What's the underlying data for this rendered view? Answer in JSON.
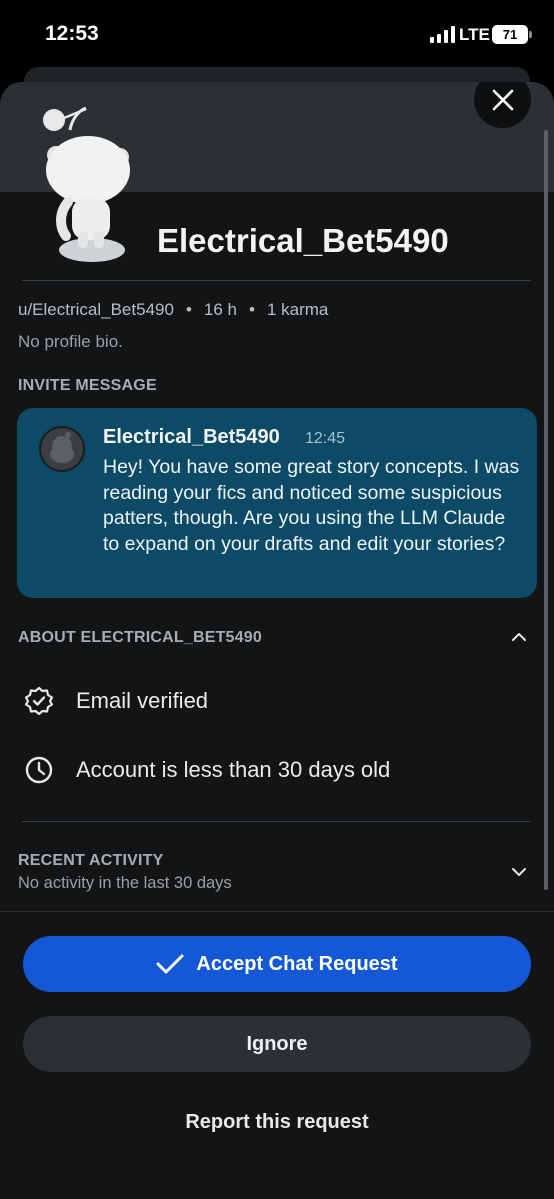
{
  "status_bar": {
    "time": "12:53",
    "network": "LTE",
    "battery": "71"
  },
  "profile": {
    "display_name": "Electrical_Bet5490",
    "username": "u/Electrical_Bet5490",
    "age": "16 h",
    "karma": "1 karma",
    "bio": "No profile bio."
  },
  "invite": {
    "section_label": "INVITE MESSAGE",
    "sender": "Electrical_Bet5490",
    "time": "12:45",
    "message": "Hey! You have some great story concepts. I was reading your fics and noticed some suspicious patters, though. Are you using the LLM Claude to expand on your drafts and edit your stories?"
  },
  "about": {
    "section_label": "ABOUT ELECTRICAL_BET5490",
    "items": [
      {
        "icon": "verified-badge-icon",
        "label": "Email verified"
      },
      {
        "icon": "clock-icon",
        "label": "Account is less than 30 days old"
      }
    ]
  },
  "activity": {
    "section_label": "RECENT ACTIVITY",
    "subtitle": "No activity in the last 30 days"
  },
  "actions": {
    "accept_label": "Accept Chat Request",
    "ignore_label": "Ignore",
    "report_label": "Report this request"
  },
  "colors": {
    "accent_blue": "#1558d6",
    "invite_card": "#0c4a66",
    "sheet_bg": "#121416"
  }
}
